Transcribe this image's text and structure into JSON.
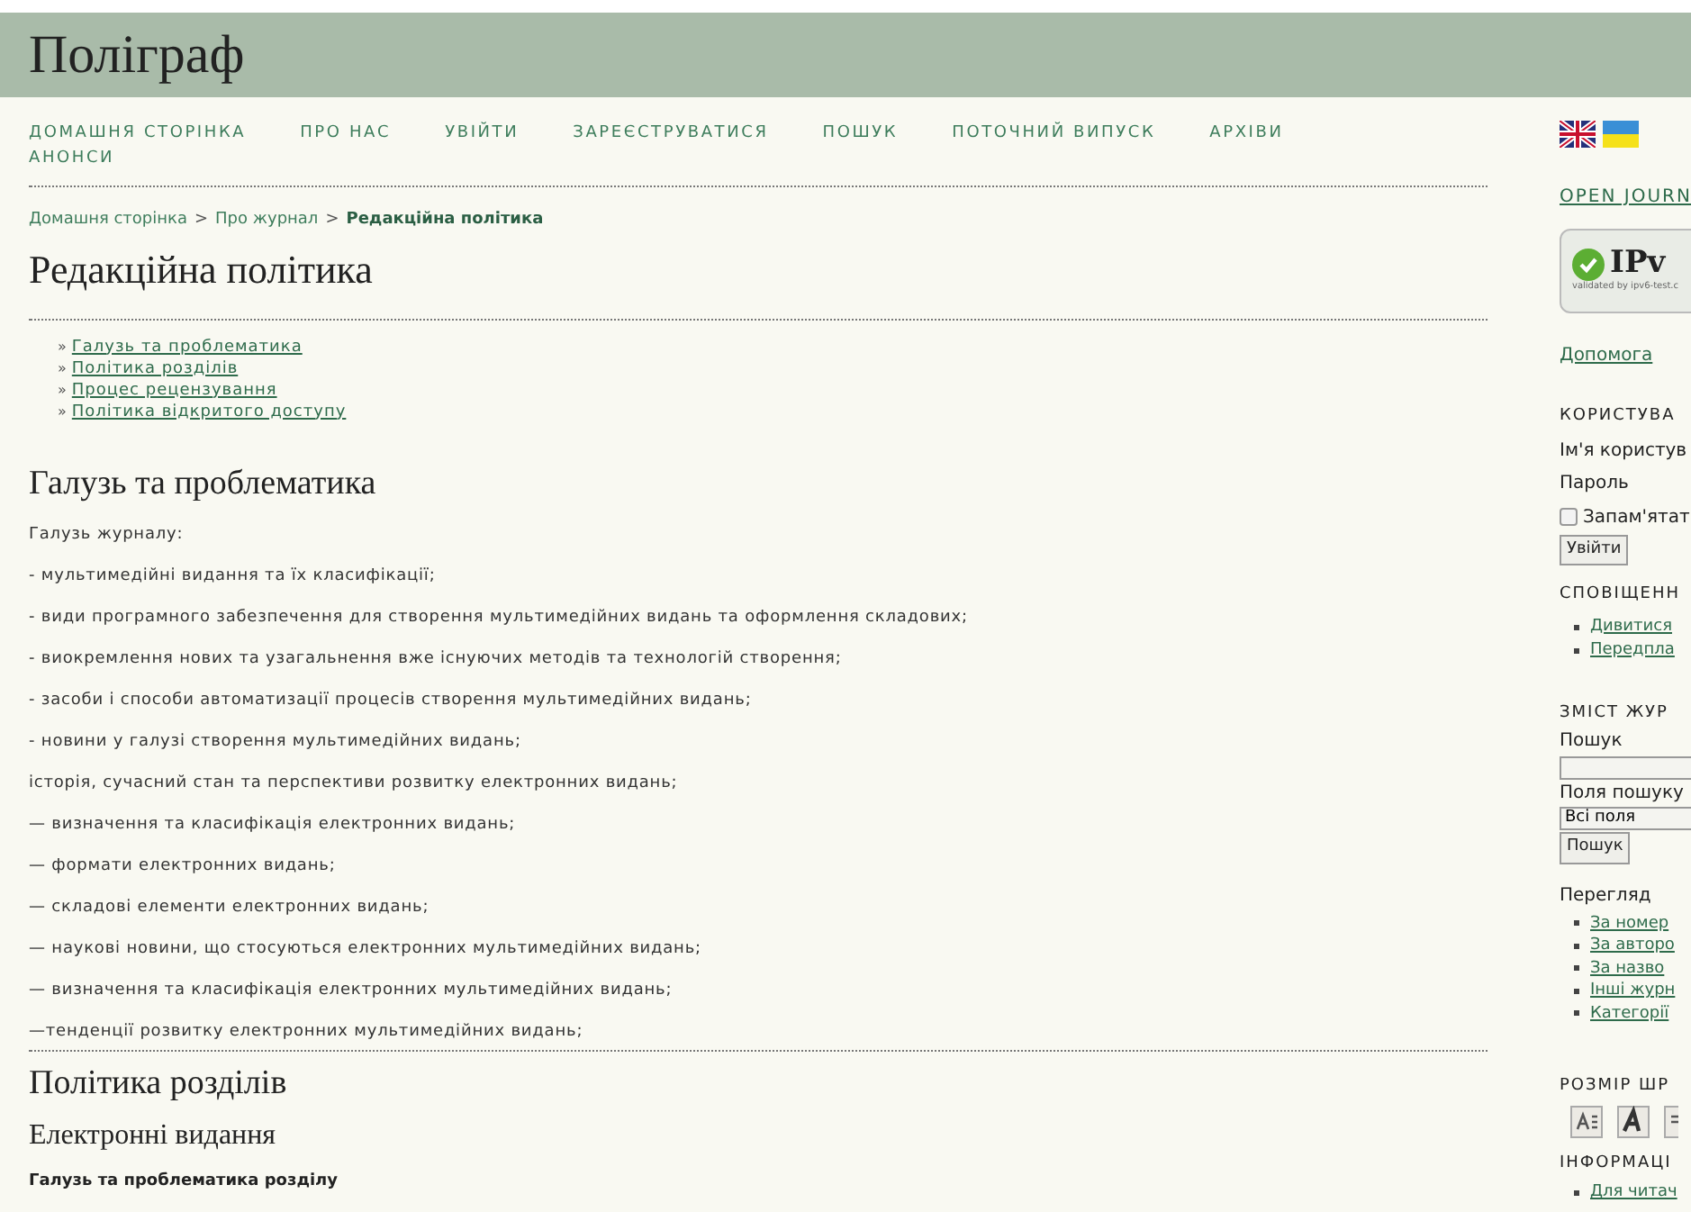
{
  "header": {
    "title": "Поліграф"
  },
  "nav": [
    "ДОМАШНЯ СТОРІНКА",
    "ПРО НАС",
    "УВІЙТИ",
    "ЗАРЕЄСТРУВАТИСЯ",
    "ПОШУК",
    "ПОТОЧНИЙ ВИПУСК",
    "АРХІВИ",
    "АНОНСИ"
  ],
  "breadcrumb": [
    {
      "kind": "link",
      "text": "Домашня сторінка",
      "current": false
    },
    {
      "kind": "separator",
      "text": ">"
    },
    {
      "kind": "link",
      "text": "Про журнал",
      "current": false
    },
    {
      "kind": "separator",
      "text": ">"
    },
    {
      "kind": "link",
      "text": "Редакційна політика",
      "current": true
    }
  ],
  "page_title": "Редакційна політика",
  "toc": [
    {
      "marker": "»",
      "label": "Галузь та проблематика"
    },
    {
      "marker": "»",
      "label": "Політика розділів"
    },
    {
      "marker": "»",
      "label": "Процес рецензування"
    },
    {
      "marker": "»",
      "label": "Політика відкритого доступу"
    }
  ],
  "scope_section": {
    "title": "Галузь та проблематика",
    "paragraphs": [
      "Галузь журналу:",
      "- мультимедійні видання та їх класифікації;",
      "- види програмного забезпечення для створення мультимедійних видань та оформлення складових;",
      "- виокремлення нових та узагальнення вже існуючих методів та технологій створення;",
      "- засоби і способи автоматизації процесів створення мультимедійних видань;",
      "- новини у галузі створення мультимедійних видань;",
      "історія, сучасний стан та перспективи розвитку електронних видань;",
      "— визначення та класифікація електронних видань;",
      "— формати електронних видань;",
      "— складові елементи електронних видань;",
      "— наукові новини, що стосуються електронних мультимедійних видань;",
      "— визначення та класифікація електронних мультимедійних видань;",
      "—тенденції розвитку електронних мультимедійних видань;"
    ]
  },
  "policy_section": {
    "title": "Політика розділів",
    "subsection": "Електронні видання",
    "subheading": "Галузь та проблематика розділу"
  },
  "sidebar": {
    "ojs_link": "OPEN JOURN",
    "badge": {
      "title": "IPv",
      "caption": "validated by ipv6-test.c"
    },
    "help_link": "Допомога",
    "user": {
      "heading": "КОРИСТУВА",
      "username_label": "Ім'я користув",
      "password_label": "Пароль",
      "remember": {
        "label": "Запам'ятат",
        "checked": false
      },
      "button": "Увійти"
    },
    "notifications": {
      "heading": "СПОВІЩЕНН",
      "links": [
        "Дивитися",
        "Передпла"
      ]
    },
    "journal_content": {
      "heading": "ЗМІСТ ЖУР",
      "search_label": "Пошук",
      "fields_label": "Поля пошуку",
      "fields_value": "Всі поля",
      "button": "Пошук",
      "browse_label": "Перегляд",
      "browse_links": [
        "За номер",
        "За авторо",
        "За назво",
        "Інші журн",
        "Категорії"
      ]
    },
    "font_size": {
      "heading": "РОЗМІР ШР"
    },
    "information": {
      "heading": "ІНФОРМАЦІ",
      "links": [
        "Для читач"
      ]
    }
  }
}
